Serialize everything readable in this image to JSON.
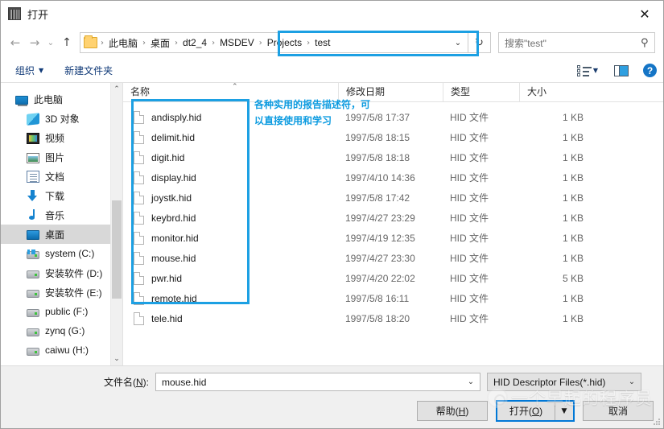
{
  "window": {
    "title": "打开",
    "icon": "app-icon",
    "close_label": "✕"
  },
  "nav": {
    "back": "←",
    "forward": "→",
    "history": "⌄",
    "up": "↑",
    "dropdown": "⌄",
    "refresh": "↻"
  },
  "breadcrumb": {
    "segments": [
      "此电脑",
      "桌面",
      "dt2_4",
      "MSDEV",
      "Projects",
      "test"
    ],
    "separator": "›",
    "highlight_from": 2
  },
  "search": {
    "placeholder": "搜索\"test\"",
    "icon": "search-icon"
  },
  "toolbar": {
    "organize_label": "组织",
    "organize_caret": "▼",
    "new_folder_label": "新建文件夹",
    "views_caret": "▼",
    "preview_pane_icon": "preview-pane-icon",
    "help_label": "?"
  },
  "sidebar": {
    "items": [
      {
        "label": "此电脑",
        "icon": "pc-icon",
        "level": "root",
        "selected": false
      },
      {
        "label": "3D 对象",
        "icon": "3d-icon",
        "level": "child",
        "selected": false
      },
      {
        "label": "视频",
        "icon": "video-icon",
        "level": "child",
        "selected": false
      },
      {
        "label": "图片",
        "icon": "picture-icon",
        "level": "child",
        "selected": false
      },
      {
        "label": "文档",
        "icon": "document-icon",
        "level": "child",
        "selected": false
      },
      {
        "label": "下载",
        "icon": "download-icon",
        "level": "child",
        "selected": false
      },
      {
        "label": "音乐",
        "icon": "music-icon",
        "level": "child",
        "selected": false
      },
      {
        "label": "桌面",
        "icon": "desktop-icon",
        "level": "child",
        "selected": true
      },
      {
        "label": "system (C:)",
        "icon": "system-drive-icon",
        "level": "child",
        "selected": false
      },
      {
        "label": "安装软件 (D:)",
        "icon": "drive-icon",
        "level": "child",
        "selected": false
      },
      {
        "label": "安装软件 (E:)",
        "icon": "drive-icon",
        "level": "child",
        "selected": false
      },
      {
        "label": "public (F:)",
        "icon": "drive-icon",
        "level": "child",
        "selected": false
      },
      {
        "label": "zynq (G:)",
        "icon": "drive-icon",
        "level": "child",
        "selected": false
      },
      {
        "label": "caiwu (H:)",
        "icon": "drive-icon",
        "level": "child",
        "selected": false
      }
    ],
    "scroll_up": "⌃",
    "scroll_down": "⌄"
  },
  "filelist": {
    "columns": [
      "名称",
      "修改日期",
      "类型",
      "大小"
    ],
    "sort_indicator": "⌃",
    "rows": [
      {
        "name": "andisply.hid",
        "date": "1997/5/8 17:37",
        "type": "HID 文件",
        "size": "1 KB"
      },
      {
        "name": "delimit.hid",
        "date": "1997/5/8 18:15",
        "type": "HID 文件",
        "size": "1 KB"
      },
      {
        "name": "digit.hid",
        "date": "1997/5/8 18:18",
        "type": "HID 文件",
        "size": "1 KB"
      },
      {
        "name": "display.hid",
        "date": "1997/4/10 14:36",
        "type": "HID 文件",
        "size": "1 KB"
      },
      {
        "name": "joystk.hid",
        "date": "1997/5/8 17:42",
        "type": "HID 文件",
        "size": "1 KB"
      },
      {
        "name": "keybrd.hid",
        "date": "1997/4/27 23:29",
        "type": "HID 文件",
        "size": "1 KB"
      },
      {
        "name": "monitor.hid",
        "date": "1997/4/19 12:35",
        "type": "HID 文件",
        "size": "1 KB"
      },
      {
        "name": "mouse.hid",
        "date": "1997/4/27 23:30",
        "type": "HID 文件",
        "size": "1 KB"
      },
      {
        "name": "pwr.hid",
        "date": "1997/4/20 22:02",
        "type": "HID 文件",
        "size": "5 KB"
      },
      {
        "name": "remote.hid",
        "date": "1997/5/8 16:11",
        "type": "HID 文件",
        "size": "1 KB"
      },
      {
        "name": "tele.hid",
        "date": "1997/5/8 18:20",
        "type": "HID 文件",
        "size": "1 KB"
      }
    ]
  },
  "annotation": {
    "text": "各种实用的报告描述符，可以直接使用和学习",
    "color": "#0c9be0"
  },
  "footer": {
    "filename_label_pre": "文件名(",
    "filename_label_key": "N",
    "filename_label_post": "):",
    "filename_value": "mouse.hid",
    "filename_caret": "⌄",
    "filetype_value": "HID Descriptor Files(*.hid)",
    "filetype_caret": "⌄",
    "help_button_pre": "帮助(",
    "help_button_key": "H",
    "help_button_post": ")",
    "open_button_pre": "打开(",
    "open_button_key": "O",
    "open_button_post": ")",
    "open_button_arrow": "▼",
    "cancel_button": "取消"
  },
  "watermark": {
    "text": "一个早起的程序员"
  },
  "colors": {
    "highlight": "#1ca0e3",
    "accent": "#0078d7",
    "selection": "#d8d8d8"
  }
}
